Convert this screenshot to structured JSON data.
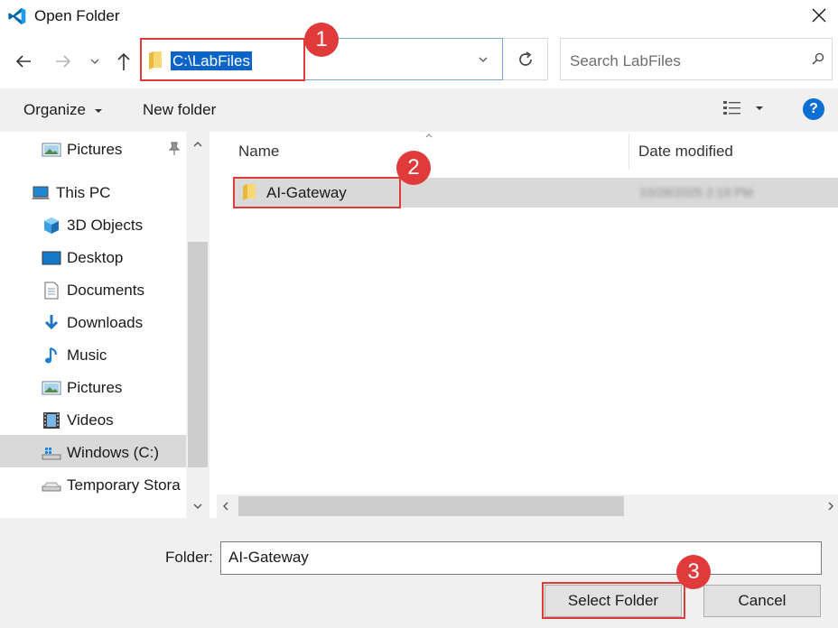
{
  "window": {
    "title": "Open Folder",
    "app_icon": "vscode-icon",
    "close_icon": "close-icon"
  },
  "address": {
    "path": "C:\\LabFiles",
    "folder_icon": "folder-icon"
  },
  "search": {
    "placeholder": "Search LabFiles"
  },
  "toolbar": {
    "organize_label": "Organize",
    "new_folder_label": "New folder"
  },
  "nav": {
    "items": [
      {
        "label": "Pictures",
        "icon": "pictures-icon"
      },
      {
        "label": "This PC",
        "icon": "computer-icon"
      },
      {
        "label": "3D Objects",
        "icon": "cube-icon"
      },
      {
        "label": "Desktop",
        "icon": "desktop-icon"
      },
      {
        "label": "Documents",
        "icon": "documents-icon"
      },
      {
        "label": "Downloads",
        "icon": "download-icon"
      },
      {
        "label": "Music",
        "icon": "music-icon"
      },
      {
        "label": "Pictures",
        "icon": "pictures-icon"
      },
      {
        "label": "Videos",
        "icon": "videos-icon"
      },
      {
        "label": "Windows (C:)",
        "icon": "drive-icon"
      },
      {
        "label": "Temporary Stora",
        "icon": "drive-icon"
      }
    ],
    "selected": "Windows (C:)"
  },
  "list": {
    "columns": [
      "Name",
      "Date modified"
    ],
    "rows": [
      {
        "name": "AI-Gateway",
        "date_modified": "10/28/2025 2:19 PM"
      }
    ]
  },
  "footer": {
    "folder_label": "Folder:",
    "folder_value": "AI-Gateway",
    "select_label": "Select Folder",
    "cancel_label": "Cancel"
  },
  "callouts": [
    "1",
    "2",
    "3"
  ],
  "colors": {
    "accent": "#0a64c8",
    "callout": "#e03a3a",
    "selection": "#d9d9d9"
  }
}
